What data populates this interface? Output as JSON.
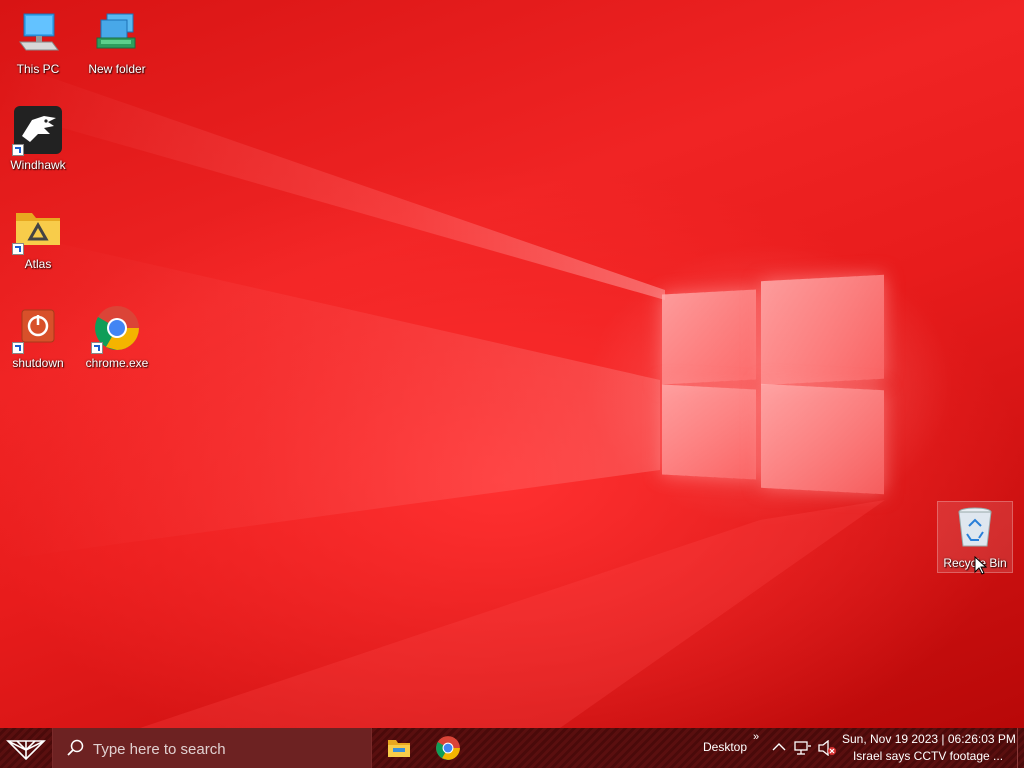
{
  "desktop": {
    "icons": [
      {
        "label": "This PC",
        "icon": "this-pc-icon"
      },
      {
        "label": "New folder",
        "icon": "network-folder-icon"
      },
      {
        "label": "Windhawk",
        "icon": "windhawk-eagle-icon"
      },
      {
        "label": "Atlas",
        "icon": "atlas-folder-icon"
      },
      {
        "label": "shutdown",
        "icon": "power-icon"
      },
      {
        "label": "chrome.exe",
        "icon": "chrome-icon"
      },
      {
        "label": "Recycle Bin",
        "icon": "recycle-bin-icon"
      }
    ]
  },
  "taskbar": {
    "search_placeholder": "Type here to search",
    "desktop_label": "Desktop",
    "overflow_glyph": "»",
    "tray_chevron": "^",
    "clock_line1": "Sun, Nov 19 2023 | 06:26:03 PM",
    "clock_line2": "Israel says CCTV footage ..."
  },
  "colors": {
    "wallpaper": "#e01818",
    "taskbar": "#4a0a0a",
    "search_box": "#6d2222"
  }
}
